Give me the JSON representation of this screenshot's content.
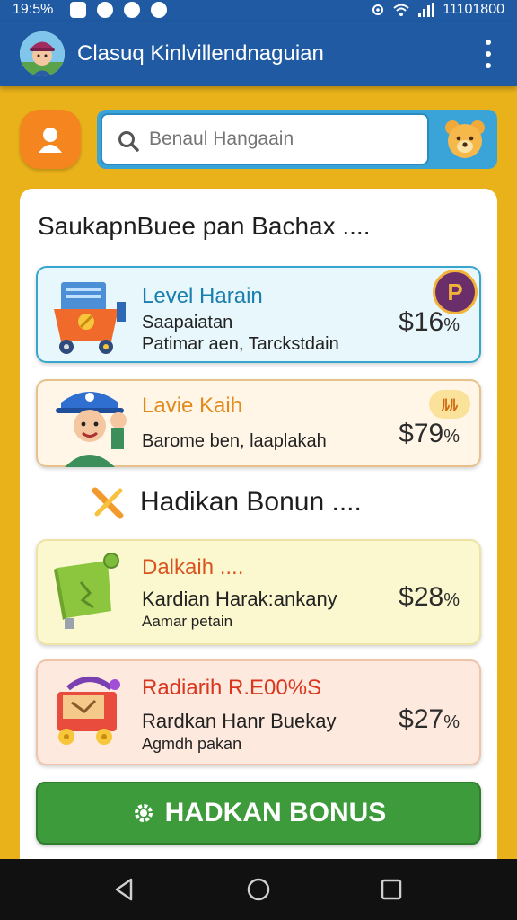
{
  "status_bar": {
    "time": "19:5%",
    "right_text": "11101800"
  },
  "app_bar": {
    "title": "Clasuq Kinlvillendnaguian"
  },
  "search": {
    "placeholder": "Benaul Hangaain"
  },
  "panel": {
    "heading": "SaukapnBuee pan Bachax ...."
  },
  "cards_top": [
    {
      "title": "Level Harain",
      "lines": [
        "Saapaiatan",
        "Patimar aen, Tarckstdain"
      ],
      "price": "$16",
      "price_suffix": "%",
      "badge": "P",
      "title_color": "#1a7fae",
      "badge_color": "#6a2f6b"
    },
    {
      "title": "Lavie Kaih",
      "lines": [
        "Barome ben, laaplakah"
      ],
      "price": "$79",
      "price_suffix": "%",
      "badge": "ﾙﾙ",
      "title_color": "#e28a1b",
      "badge_color": "#f6b93b"
    }
  ],
  "section2": {
    "title": "Hadikan Bonun  ...."
  },
  "cards_bottom": [
    {
      "title": "Dalkaih ....",
      "lines": [
        "Kardian Harak:ankany",
        "Aamar petain"
      ],
      "price": "$28",
      "price_suffix": "%",
      "title_color": "#d9541e"
    },
    {
      "title": "Radiarih R.E00%S",
      "lines": [
        "Rardkan Hanr Buekay",
        "Agmdh pakan"
      ],
      "price": "$27",
      "price_suffix": "%",
      "title_color": "#d9361e"
    }
  ],
  "bonus_button": {
    "label": "HADKAN BONUS"
  },
  "colors": {
    "brand_blue": "#1f5aa3",
    "background_yellow": "#e9b21a",
    "button_green": "#3d9b3c",
    "accent_orange": "#f5861f"
  }
}
